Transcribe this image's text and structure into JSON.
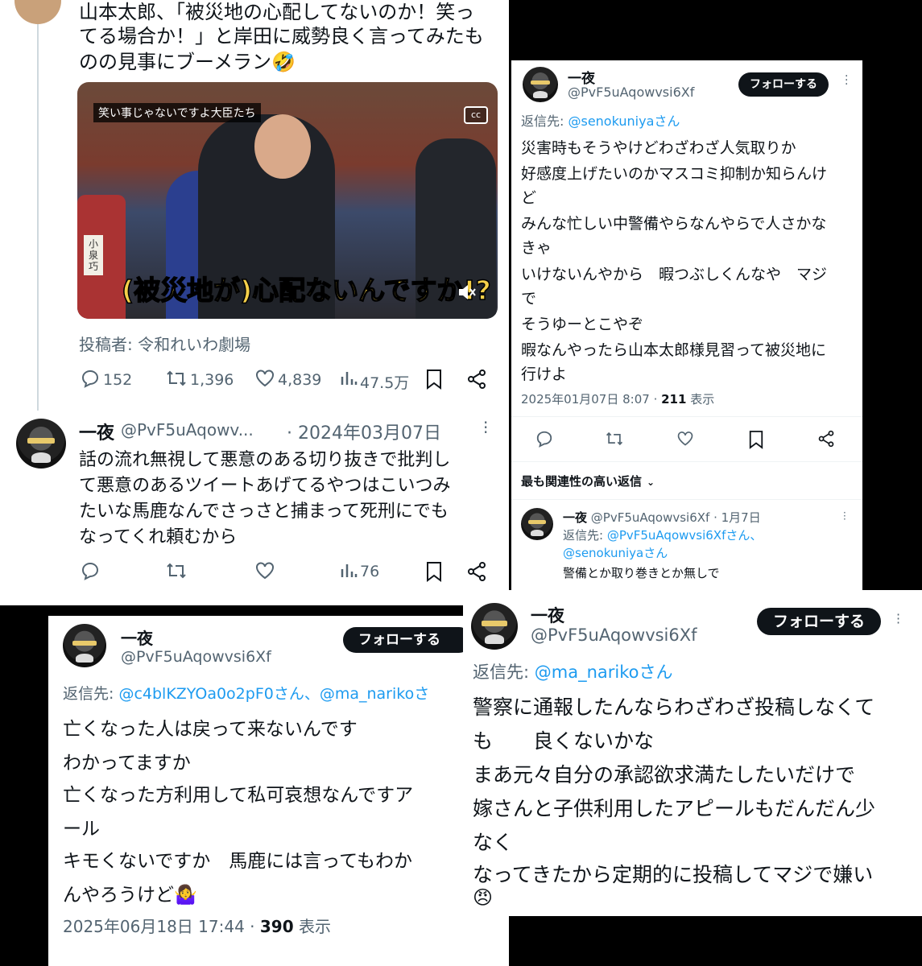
{
  "p1": {
    "top_text": [
      "山本太郎、「被災地の心配してないのか！笑っ",
      "てる場合か！」と岸田に威勢良く言ってみたも",
      "のの見事にブーメラン🤣"
    ],
    "video_caption_top": "笑い事じゃないですよ大臣たち",
    "video_caption_main": "(被災地が)心配ないんですか!?",
    "nameplate": "小泉巧",
    "cc": "cc",
    "source": "投稿者: 令和れいわ劇場",
    "stats": {
      "replies": "152",
      "retweets": "1,396",
      "likes": "4,839",
      "views": "47.5万"
    },
    "reply": {
      "name": "一夜",
      "handle": "@PvF5uAqowv...",
      "date": "· 2024年03月07日",
      "lines": [
        "話の流れ無視して悪意のある切り抜きで批判し",
        "て悪意のあるツイートあげてるやつはこいつみ",
        "たいな馬鹿なんでさっさと捕まって死刑にでも",
        "なってくれ頼むから"
      ],
      "views": "76"
    }
  },
  "p2": {
    "name": "一夜",
    "handle": "@PvF5uAqowvsi6Xf",
    "follow": "フォローする",
    "reply_to_prefix": "返信先: ",
    "reply_to_user": "@senokuniyaさん",
    "lines": [
      "災害時もそうやけどわざわざ人気取りか",
      "好感度上げたいのかマスコミ抑制か知らんけ",
      "ど",
      "みんな忙しい中警備やらなんやらで人さかな",
      "きゃ",
      "いけないんやから　暇つぶしくんなや　マジ",
      "で",
      "そうゆーとこやぞ",
      "暇なんやったら山本太郎様見習って被災地に",
      "行けよ"
    ],
    "timestamp": "2025年01月07日 8:07 · ",
    "views_count": "211",
    "views_label": " 表示",
    "relevant": "最も関連性の高い返信",
    "sub": {
      "name": "一夜",
      "handle": "@PvF5uAqowvsi6Xf · 1月7日",
      "reply_prefix": "返信先: ",
      "reply_users_1": "@PvF5uAqowvsi6Xfさん、",
      "reply_users_2": "@senokuniyaさん",
      "text": "警備とか取り巻きとか無しで"
    }
  },
  "p3": {
    "name": "一夜",
    "handle": "@PvF5uAqowvsi6Xf",
    "follow": "フォローする",
    "reply_to_prefix": "返信先: ",
    "reply_to_users": "@c4blKZYOa0o2pF0さん、@ma_narikoさ",
    "lines": [
      "亡くなった人は戻って来ないんです",
      "わかってますか",
      "亡くなった方利用して私可哀想なんですア",
      "ール",
      "キモくないですか　馬鹿には言ってもわか",
      "んやろうけど🤷‍♀️"
    ],
    "timestamp": "2025年06月18日 17:44 · ",
    "views_count": "390",
    "views_label": " 表示"
  },
  "p4": {
    "name": "一夜",
    "handle": "@PvF5uAqowvsi6Xf",
    "follow": "フォローする",
    "reply_to_prefix": "返信先: ",
    "reply_to_user": "@ma_narikoさん",
    "lines": [
      "警察に通報したんならわざわざ投稿しなくて",
      "も　　良くないかな",
      "まあ元々自分の承認欲求満たしたいだけで",
      "嫁さんと子供利用したアピールもだんだん少",
      "なく",
      "なってきたから定期的に投稿してマジで嫌い",
      "😠"
    ]
  },
  "colors": {
    "link": "#1d9bf0",
    "muted": "#536471",
    "text": "#0f1419"
  }
}
